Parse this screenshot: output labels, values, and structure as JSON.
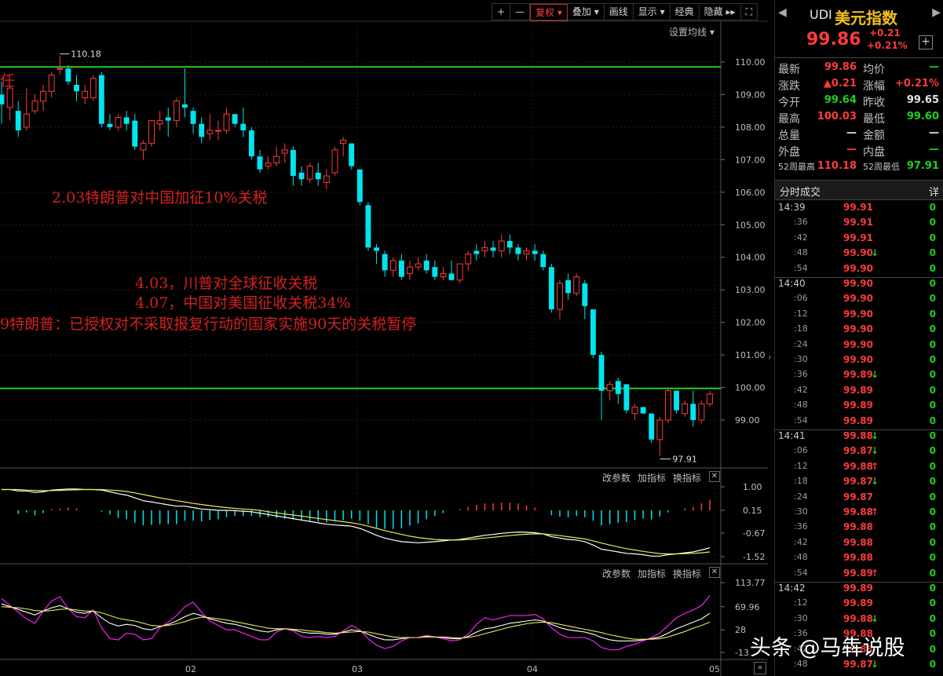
{
  "toolbar": {
    "buttons": [
      "+",
      "—",
      "复权",
      "叠加",
      "画线",
      "显示",
      "经典",
      "隐藏"
    ],
    "set_ma": "设置均线"
  },
  "chart_data": {
    "type": "candlestick",
    "ylim": [
      97.3,
      110.8
    ],
    "y_ticks": [
      "110.00",
      "109.00",
      "108.00",
      "107.00",
      "106.00",
      "105.00",
      "104.00",
      "103.00",
      "102.00",
      "101.00",
      "100.00",
      "99.00"
    ],
    "x_ticks": [
      "02",
      "03",
      "04",
      "05"
    ],
    "hlines": [
      109.85,
      99.97
    ],
    "high_label": "110.18",
    "low_label": "97.91",
    "candles": [
      [
        109.0,
        109.4,
        108.1,
        108.7
      ],
      [
        108.6,
        109.3,
        108.2,
        109.2
      ],
      [
        108.5,
        108.8,
        107.7,
        107.9
      ],
      [
        108.0,
        109.2,
        107.9,
        108.4
      ],
      [
        108.5,
        109.0,
        108.4,
        108.8
      ],
      [
        108.8,
        109.3,
        108.5,
        109.1
      ],
      [
        109.1,
        109.7,
        108.9,
        109.6
      ],
      [
        109.8,
        110.2,
        109.6,
        109.8
      ],
      [
        109.8,
        109.9,
        109.3,
        109.4
      ],
      [
        109.3,
        109.6,
        108.8,
        109.1
      ],
      [
        108.9,
        109.3,
        108.7,
        109.1
      ],
      [
        108.9,
        109.6,
        108.8,
        109.5
      ],
      [
        109.6,
        109.7,
        108.0,
        108.1
      ],
      [
        108.1,
        108.4,
        107.9,
        108.0
      ],
      [
        108.0,
        108.4,
        107.9,
        108.3
      ],
      [
        108.3,
        108.5,
        107.9,
        108.1
      ],
      [
        108.2,
        108.4,
        107.3,
        107.4
      ],
      [
        107.3,
        107.6,
        107.0,
        107.5
      ],
      [
        107.5,
        108.2,
        107.4,
        108.2
      ],
      [
        108.1,
        108.5,
        107.9,
        108.2
      ],
      [
        108.3,
        108.6,
        107.7,
        108.2
      ],
      [
        108.2,
        108.9,
        108.0,
        108.8
      ],
      [
        108.7,
        109.8,
        108.3,
        108.6
      ],
      [
        108.5,
        108.6,
        107.8,
        108.1
      ],
      [
        108.1,
        108.3,
        107.5,
        107.7
      ],
      [
        107.8,
        108.4,
        107.6,
        107.9
      ],
      [
        107.9,
        108.2,
        107.6,
        107.9
      ],
      [
        107.9,
        108.6,
        107.8,
        108.4
      ],
      [
        108.4,
        108.4,
        108.0,
        108.1
      ],
      [
        108.1,
        108.6,
        107.7,
        107.9
      ],
      [
        107.9,
        108.0,
        107.0,
        107.1
      ],
      [
        107.1,
        107.3,
        106.6,
        106.7
      ],
      [
        106.8,
        107.1,
        106.7,
        106.9
      ],
      [
        106.9,
        107.4,
        106.8,
        107.1
      ],
      [
        107.2,
        107.5,
        106.9,
        107.3
      ],
      [
        107.3,
        107.4,
        106.2,
        106.5
      ],
      [
        106.6,
        106.8,
        106.2,
        106.4
      ],
      [
        106.4,
        106.9,
        106.3,
        106.8
      ],
      [
        106.6,
        106.9,
        106.2,
        106.4
      ],
      [
        106.3,
        106.7,
        106.1,
        106.5
      ],
      [
        106.6,
        107.4,
        106.5,
        107.3
      ],
      [
        107.5,
        107.7,
        107.1,
        107.6
      ],
      [
        107.5,
        107.5,
        106.7,
        106.8
      ],
      [
        106.7,
        106.7,
        105.6,
        105.7
      ],
      [
        105.6,
        105.7,
        104.2,
        104.3
      ],
      [
        104.3,
        104.4,
        103.8,
        104.2
      ],
      [
        104.1,
        104.2,
        103.4,
        103.6
      ],
      [
        103.6,
        104.0,
        103.4,
        103.9
      ],
      [
        103.9,
        104.1,
        103.3,
        103.4
      ],
      [
        103.5,
        103.9,
        103.3,
        103.7
      ],
      [
        103.7,
        104.0,
        103.6,
        103.8
      ],
      [
        103.9,
        104.1,
        103.5,
        103.6
      ],
      [
        103.7,
        103.9,
        103.3,
        103.4
      ],
      [
        103.4,
        103.7,
        103.3,
        103.5
      ],
      [
        103.5,
        103.9,
        103.3,
        103.3
      ],
      [
        103.3,
        103.8,
        103.2,
        103.8
      ],
      [
        103.8,
        104.2,
        103.6,
        104.1
      ],
      [
        104.2,
        104.4,
        103.9,
        104.1
      ],
      [
        104.2,
        104.5,
        104.0,
        104.3
      ],
      [
        104.3,
        104.5,
        104.0,
        104.2
      ],
      [
        104.2,
        104.7,
        104.0,
        104.5
      ],
      [
        104.5,
        104.7,
        104.1,
        104.3
      ],
      [
        104.3,
        104.4,
        103.9,
        104.1
      ],
      [
        104.1,
        104.3,
        103.9,
        104.2
      ],
      [
        104.2,
        104.4,
        103.9,
        104.1
      ],
      [
        104.1,
        104.2,
        103.6,
        103.7
      ],
      [
        103.7,
        103.8,
        102.3,
        102.4
      ],
      [
        102.4,
        103.3,
        102.1,
        103.2
      ],
      [
        103.3,
        103.5,
        102.7,
        102.9
      ],
      [
        102.9,
        103.5,
        102.8,
        103.4
      ],
      [
        103.2,
        103.3,
        102.1,
        102.5
      ],
      [
        102.4,
        102.4,
        100.9,
        101.0
      ],
      [
        101.0,
        101.1,
        99.0,
        99.9
      ],
      [
        99.9,
        100.2,
        99.6,
        100.1
      ],
      [
        100.2,
        100.3,
        99.5,
        99.8
      ],
      [
        100.1,
        100.1,
        99.2,
        99.3
      ],
      [
        99.2,
        99.5,
        99.0,
        99.4
      ],
      [
        99.4,
        99.4,
        99.2,
        99.2
      ],
      [
        99.2,
        99.2,
        98.3,
        98.4
      ],
      [
        98.4,
        99.1,
        97.9,
        99.0
      ],
      [
        99.0,
        100.0,
        98.9,
        99.9
      ],
      [
        99.9,
        99.9,
        99.2,
        99.3
      ],
      [
        99.2,
        99.6,
        99.1,
        99.5
      ],
      [
        99.5,
        99.9,
        98.8,
        99.0
      ],
      [
        99.0,
        99.6,
        98.9,
        99.5
      ],
      [
        99.5,
        99.9,
        99.4,
        99.8
      ]
    ],
    "macd_panel": {
      "buttons": [
        "改参数",
        "加指标",
        "换指标"
      ],
      "y_ticks": [
        "1.00",
        "0.15",
        "-0.67",
        "-1.52"
      ],
      "dif": [
        0.9,
        0.9,
        0.85,
        0.85,
        0.8,
        0.82,
        0.88,
        0.9,
        0.92,
        0.92,
        0.9,
        0.9,
        0.88,
        0.82,
        0.75,
        0.7,
        0.6,
        0.5,
        0.45,
        0.4,
        0.35,
        0.3,
        0.3,
        0.25,
        0.2,
        0.18,
        0.15,
        0.15,
        0.14,
        0.12,
        0.1,
        0.05,
        0.0,
        -0.05,
        -0.1,
        -0.15,
        -0.2,
        -0.25,
        -0.3,
        -0.35,
        -0.38,
        -0.4,
        -0.42,
        -0.5,
        -0.62,
        -0.75,
        -0.85,
        -0.92,
        -0.98,
        -1.0,
        -1.02,
        -1.0,
        -0.98,
        -0.95,
        -0.92,
        -0.9,
        -0.85,
        -0.8,
        -0.75,
        -0.72,
        -0.68,
        -0.65,
        -0.63,
        -0.64,
        -0.66,
        -0.7,
        -0.8,
        -0.85,
        -0.9,
        -0.92,
        -0.98,
        -1.1,
        -1.25,
        -1.3,
        -1.35,
        -1.4,
        -1.42,
        -1.45,
        -1.5,
        -1.5,
        -1.45,
        -1.42,
        -1.38,
        -1.35,
        -1.28,
        -1.2
      ],
      "dea": [
        0.9,
        0.9,
        0.9,
        0.88,
        0.87,
        0.86,
        0.86,
        0.87,
        0.88,
        0.89,
        0.9,
        0.9,
        0.9,
        0.88,
        0.86,
        0.83,
        0.78,
        0.72,
        0.66,
        0.6,
        0.55,
        0.5,
        0.45,
        0.4,
        0.36,
        0.32,
        0.28,
        0.25,
        0.22,
        0.2,
        0.18,
        0.15,
        0.1,
        0.06,
        0.02,
        -0.02,
        -0.06,
        -0.1,
        -0.14,
        -0.18,
        -0.22,
        -0.26,
        -0.3,
        -0.35,
        -0.42,
        -0.5,
        -0.58,
        -0.65,
        -0.72,
        -0.78,
        -0.83,
        -0.87,
        -0.9,
        -0.91,
        -0.92,
        -0.92,
        -0.9,
        -0.88,
        -0.85,
        -0.82,
        -0.79,
        -0.76,
        -0.73,
        -0.71,
        -0.7,
        -0.7,
        -0.73,
        -0.76,
        -0.8,
        -0.84,
        -0.88,
        -0.95,
        -1.03,
        -1.1,
        -1.17,
        -1.23,
        -1.28,
        -1.33,
        -1.37,
        -1.41,
        -1.42,
        -1.42,
        -1.41,
        -1.4,
        -1.38,
        -1.35
      ]
    },
    "kdj_panel": {
      "buttons": [
        "改参数",
        "加指标",
        "换指标"
      ],
      "y_ticks": [
        "113.77",
        "69.96",
        "28",
        "-13"
      ],
      "k": [
        75,
        70,
        65,
        60,
        55,
        62,
        68,
        72,
        66,
        60,
        58,
        62,
        50,
        40,
        35,
        38,
        36,
        30,
        28,
        34,
        38,
        44,
        52,
        58,
        54,
        48,
        44,
        40,
        38,
        34,
        30,
        26,
        24,
        28,
        30,
        28,
        24,
        22,
        22,
        20,
        20,
        24,
        28,
        26,
        20,
        14,
        10,
        10,
        12,
        14,
        14,
        16,
        15,
        14,
        12,
        12,
        16,
        24,
        30,
        32,
        36,
        40,
        42,
        44,
        46,
        44,
        38,
        32,
        28,
        26,
        24,
        20,
        14,
        10,
        8,
        8,
        8,
        10,
        12,
        15,
        22,
        30,
        36,
        42,
        48,
        58
      ],
      "d": [
        70,
        69,
        68,
        66,
        63,
        62,
        63,
        65,
        66,
        64,
        62,
        62,
        59,
        54,
        49,
        46,
        44,
        40,
        36,
        35,
        36,
        39,
        43,
        48,
        51,
        50,
        48,
        46,
        43,
        40,
        37,
        34,
        31,
        30,
        30,
        29,
        28,
        26,
        25,
        23,
        22,
        23,
        24,
        25,
        24,
        21,
        18,
        15,
        14,
        14,
        14,
        15,
        15,
        15,
        14,
        13,
        14,
        17,
        21,
        25,
        29,
        33,
        36,
        39,
        41,
        42,
        41,
        38,
        35,
        32,
        29,
        26,
        23,
        19,
        16,
        13,
        11,
        11,
        11,
        12,
        15,
        20,
        25,
        31,
        36,
        42
      ],
      "j": [
        85,
        72,
        60,
        48,
        40,
        62,
        80,
        88,
        66,
        52,
        50,
        64,
        32,
        12,
        10,
        22,
        20,
        10,
        12,
        32,
        42,
        54,
        70,
        78,
        60,
        44,
        36,
        28,
        28,
        22,
        16,
        10,
        10,
        24,
        30,
        26,
        16,
        14,
        16,
        14,
        16,
        26,
        36,
        28,
        12,
        0,
        -6,
        -2,
        8,
        14,
        14,
        18,
        15,
        12,
        8,
        10,
        20,
        38,
        50,
        46,
        50,
        54,
        54,
        54,
        56,
        48,
        32,
        20,
        14,
        14,
        14,
        8,
        -4,
        -8,
        -8,
        -2,
        2,
        8,
        14,
        22,
        36,
        50,
        58,
        64,
        72,
        90
      ]
    },
    "annotations": [
      {
        "text": "任"
      },
      {
        "text": "2.03特朗普对中国加征10%关税"
      },
      {
        "text": "4.03，川普对全球征收关税"
      },
      {
        "text": "4.07，中国对美国征收关税34%"
      },
      {
        "text": "9特朗普：已授权对不采取报复行动的国家实施90天的关税暂停"
      }
    ]
  },
  "right_panel": {
    "code": "UDI",
    "name": "美元指数",
    "price": "99.86",
    "change": "+0.21",
    "change_pct": "+0.21%",
    "stats": [
      [
        {
          "l": "最新",
          "v": "99.86",
          "c": "red"
        },
        {
          "l": "均价",
          "v": "—",
          "c": "green"
        }
      ],
      [
        {
          "l": "涨跌",
          "v": "▲0.21",
          "c": "red"
        },
        {
          "l": "涨幅",
          "v": "+0.21%",
          "c": "red"
        }
      ],
      [
        {
          "l": "今开",
          "v": "99.64",
          "c": "green"
        },
        {
          "l": "昨收",
          "v": "99.65",
          "c": "white"
        }
      ],
      [
        {
          "l": "最高",
          "v": "100.03",
          "c": "red"
        },
        {
          "l": "最低",
          "v": "99.60",
          "c": "green"
        }
      ],
      [
        {
          "l": "总量",
          "v": "—",
          "c": "white"
        },
        {
          "l": "金额",
          "v": "—",
          "c": "white"
        }
      ],
      [
        {
          "l": "外盘",
          "v": "—",
          "c": "red"
        },
        {
          "l": "内盘",
          "v": "—",
          "c": "green"
        }
      ],
      [
        {
          "l": "52周最高",
          "v": "110.18",
          "c": "red"
        },
        {
          "l": "52周最低",
          "v": "97.91",
          "c": "green"
        }
      ]
    ],
    "ticks_header": "分时成交",
    "ticks_more": "详",
    "trades": [
      {
        "t": "14:39",
        "p": "99.91",
        "a": "",
        "v": "0"
      },
      {
        "t": ":36",
        "p": "99.91",
        "a": "",
        "v": "0"
      },
      {
        "t": ":42",
        "p": "99.91",
        "a": "",
        "v": "0"
      },
      {
        "t": ":48",
        "p": "99.90",
        "a": "down",
        "v": "0"
      },
      {
        "t": ":54",
        "p": "99.90",
        "a": "",
        "v": "0"
      },
      {
        "t": "14:40",
        "p": "99.90",
        "a": "",
        "v": "0"
      },
      {
        "t": ":06",
        "p": "99.90",
        "a": "",
        "v": "0"
      },
      {
        "t": ":12",
        "p": "99.90",
        "a": "",
        "v": "0"
      },
      {
        "t": ":18",
        "p": "99.90",
        "a": "",
        "v": "0"
      },
      {
        "t": ":24",
        "p": "99.90",
        "a": "",
        "v": "0"
      },
      {
        "t": ":30",
        "p": "99.90",
        "a": "",
        "v": "0"
      },
      {
        "t": ":36",
        "p": "99.89",
        "a": "down",
        "v": "0"
      },
      {
        "t": ":42",
        "p": "99.89",
        "a": "",
        "v": "0"
      },
      {
        "t": ":48",
        "p": "99.89",
        "a": "",
        "v": "0"
      },
      {
        "t": ":54",
        "p": "99.89",
        "a": "",
        "v": "0"
      },
      {
        "t": "14:41",
        "p": "99.88",
        "a": "down",
        "v": "0"
      },
      {
        "t": ":06",
        "p": "99.87",
        "a": "down",
        "v": "0"
      },
      {
        "t": ":12",
        "p": "99.88",
        "a": "up",
        "v": "0"
      },
      {
        "t": ":18",
        "p": "99.87",
        "a": "down",
        "v": "0"
      },
      {
        "t": ":24",
        "p": "99.87",
        "a": "",
        "v": "0"
      },
      {
        "t": ":30",
        "p": "99.88",
        "a": "up",
        "v": "0"
      },
      {
        "t": ":36",
        "p": "99.88",
        "a": "",
        "v": "0"
      },
      {
        "t": ":42",
        "p": "99.88",
        "a": "",
        "v": "0"
      },
      {
        "t": ":48",
        "p": "99.88",
        "a": "",
        "v": "0"
      },
      {
        "t": ":54",
        "p": "99.89",
        "a": "up",
        "v": "0"
      },
      {
        "t": "14:42",
        "p": "99.89",
        "a": "",
        "v": "0"
      },
      {
        "t": ":12",
        "p": "99.89",
        "a": "",
        "v": "0"
      },
      {
        "t": ":30",
        "p": "99.88",
        "a": "down",
        "v": "0"
      },
      {
        "t": ":36",
        "p": "99.88",
        "a": "",
        "v": "0"
      },
      {
        "t": ":42",
        "p": "99.88",
        "a": "",
        "v": "0"
      },
      {
        "t": ":48",
        "p": "99.87",
        "a": "down",
        "v": "0"
      }
    ]
  },
  "watermark": "头条 @马犇说股",
  "colors": {
    "up": "#ff3b3b",
    "down": "#00e5ee",
    "hline": "#22cc22",
    "annotation": "#d42020"
  }
}
